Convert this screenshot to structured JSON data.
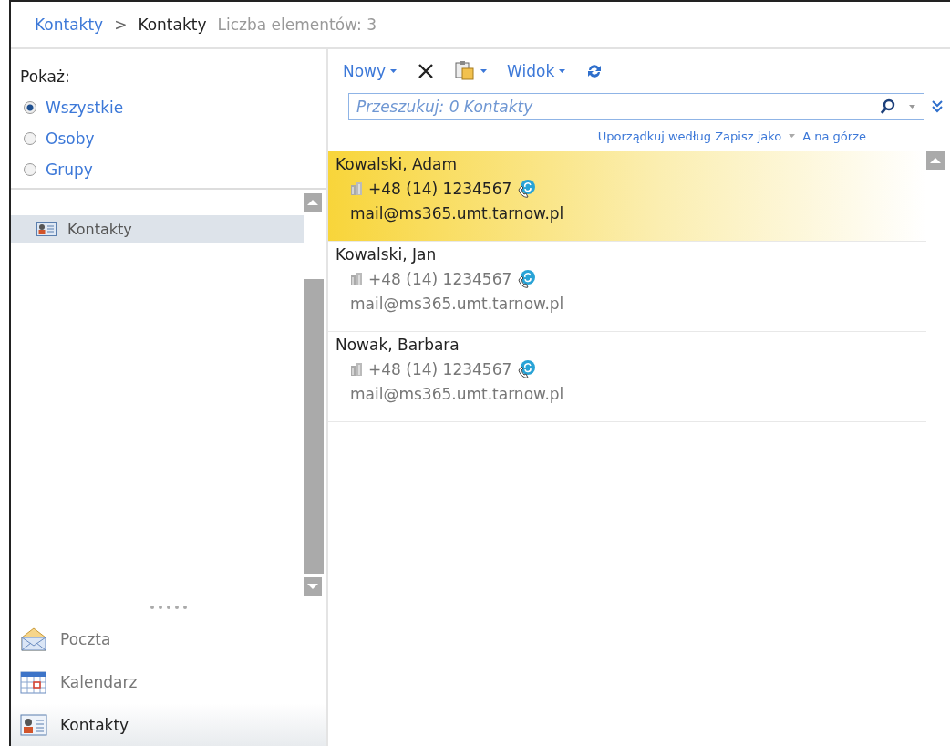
{
  "breadcrumb": {
    "parent": "Kontakty",
    "separator": ">",
    "current": "Kontakty",
    "count": "Liczba elementów: 3"
  },
  "filter": {
    "label": "Pokaż:",
    "options": [
      {
        "label": "Wszystkie",
        "selected": true
      },
      {
        "label": "Osoby",
        "selected": false
      },
      {
        "label": "Grupy",
        "selected": false
      }
    ]
  },
  "folders": [
    {
      "label": "Kontakty",
      "selected": true
    }
  ],
  "nav": [
    {
      "label": "Poczta",
      "kind": "mail",
      "selected": false
    },
    {
      "label": "Kalendarz",
      "kind": "calendar",
      "selected": false
    },
    {
      "label": "Kontakty",
      "kind": "contacts",
      "selected": true
    }
  ],
  "toolbar": {
    "new": "Nowy",
    "view": "Widok"
  },
  "search": {
    "placeholder": "Przeszukuj: 0 Kontakty"
  },
  "sort": {
    "by": "Uporządkuj według Zapisz jako",
    "order": "A na górze"
  },
  "contacts": [
    {
      "name": "Kowalski, Adam",
      "phone": "+48 (14) 1234567",
      "email": "mail@ms365.umt.tarnow.pl",
      "selected": true
    },
    {
      "name": "Kowalski, Jan",
      "phone": "+48 (14) 1234567",
      "email": "mail@ms365.umt.tarnow.pl",
      "selected": false
    },
    {
      "name": "Nowak, Barbara",
      "phone": "+48 (14) 1234567",
      "email": "mail@ms365.umt.tarnow.pl",
      "selected": false
    }
  ]
}
